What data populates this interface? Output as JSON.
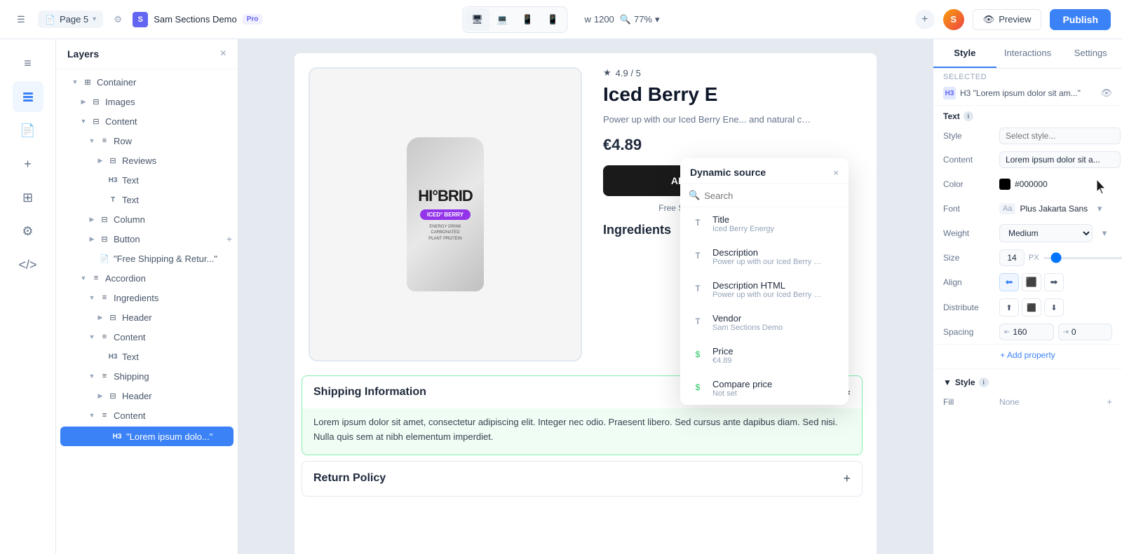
{
  "topbar": {
    "menu_icon": "☰",
    "page_name": "Page 5",
    "site_avatar_letter": "S",
    "site_name": "Sam Sections Demo",
    "pro_label": "Pro",
    "width_label": "w",
    "width_value": "1200",
    "zoom_icon": "🔍",
    "zoom_value": "77%",
    "add_icon": "+",
    "preview_label": "Preview",
    "publish_label": "Publish"
  },
  "layers": {
    "title": "Layers",
    "close_icon": "×",
    "items": [
      {
        "indent": 2,
        "expand": "▼",
        "type": "⊞",
        "name": "Container"
      },
      {
        "indent": 3,
        "expand": "▶",
        "type": "⊟",
        "name": "Images"
      },
      {
        "indent": 3,
        "expand": "▼",
        "type": "⊟",
        "name": "Content"
      },
      {
        "indent": 4,
        "expand": "▼",
        "type": "≡",
        "name": "Row"
      },
      {
        "indent": 5,
        "expand": "▶",
        "type": "⊟",
        "name": "Reviews"
      },
      {
        "indent": 5,
        "expand": "",
        "type": "T",
        "name": "H3 Text"
      },
      {
        "indent": 5,
        "expand": "",
        "type": "T",
        "name": "Text"
      },
      {
        "indent": 4,
        "expand": "▶",
        "type": "⊟",
        "name": "Column"
      },
      {
        "indent": 4,
        "expand": "▶",
        "type": "⊟",
        "name": "Button",
        "extra": "+"
      },
      {
        "indent": 4,
        "expand": "",
        "type": "📄",
        "name": "\"Free Shipping & Retur...\""
      },
      {
        "indent": 3,
        "expand": "▼",
        "type": "≡",
        "name": "Accordion"
      },
      {
        "indent": 4,
        "expand": "▼",
        "type": "≡",
        "name": "Ingredients"
      },
      {
        "indent": 5,
        "expand": "▶",
        "type": "⊟",
        "name": "Header"
      },
      {
        "indent": 4,
        "expand": "▼",
        "type": "≡",
        "name": "Content"
      },
      {
        "indent": 5,
        "expand": "",
        "type": "T",
        "name": "H3 Text"
      },
      {
        "indent": 4,
        "expand": "▼",
        "type": "≡",
        "name": "Shipping"
      },
      {
        "indent": 5,
        "expand": "▶",
        "type": "⊟",
        "name": "Header"
      },
      {
        "indent": 4,
        "expand": "▼",
        "type": "≡",
        "name": "Content"
      },
      {
        "indent": 5,
        "expand": "",
        "type": "T",
        "name": "H3 \"Lorem ipsum dolo...\"",
        "selected": true
      }
    ]
  },
  "dynamic_source": {
    "title": "Dynamic source",
    "close_icon": "×",
    "search_placeholder": "Search",
    "items": [
      {
        "icon": "T",
        "label": "Title",
        "value": "Iced Berry Energy"
      },
      {
        "icon": "T",
        "label": "Description",
        "value": "Power up with our Iced Berry Ener..."
      },
      {
        "icon": "T",
        "label": "Description HTML",
        "value": "Power up with our Iced Berry Ener..."
      },
      {
        "icon": "T",
        "label": "Vendor",
        "value": "Sam Sections Demo"
      },
      {
        "icon": "$",
        "label": "Price",
        "value": "€4.89"
      },
      {
        "icon": "$",
        "label": "Compare price",
        "value": "Not set"
      }
    ]
  },
  "canvas": {
    "rating": "★ 4.9 / 5",
    "product_name": "Iced Berry E",
    "description": "Power up with our Iced Berry Ene... and natural caffeine for a delicio...",
    "price": "€4.89",
    "add_to_cart": "ADD T",
    "free_shipping": "Free Shipping &",
    "ingredients_title": "Ingredients",
    "shipping_title": "Shipping Information",
    "shipping_text": "Lorem ipsum dolor sit amet, consectetur adipiscing elit. Integer nec odio. Praesent libero. Sed cursus ante dapibus diam. Sed nisi. Nulla quis sem at nibh elementum imperdiet.",
    "return_policy": "Return Policy",
    "can_brand": "HI°BRID",
    "can_label": "ICED° BERRY",
    "can_sub": "ENERGY DRINK\nCARBONATED\nPLANT PROTEIN"
  },
  "right_panel": {
    "tabs": [
      "Style",
      "Interactions",
      "Settings"
    ],
    "active_tab": "Style",
    "selected_label": "Selected",
    "selected_element": "H3 \"Lorem ipsum dolor sit am...\"",
    "eye_icon": "👁",
    "text_section": "Text",
    "props": {
      "style_label": "Style",
      "style_placeholder": "Select style...",
      "style_add": "+",
      "content_label": "Content",
      "content_value": "Lorem ipsum dolor sit a...",
      "content_icon": "⊞",
      "color_label": "Color",
      "color_hex": "#000000",
      "font_label": "Font",
      "font_icon": "Aa",
      "font_name": "Plus Jakarta Sans",
      "weight_label": "Weight",
      "weight_value": "Medium",
      "size_label": "Size",
      "size_value": "14",
      "size_unit": "PX",
      "align_label": "Align",
      "distribute_label": "Distribute",
      "spacing_label": "Spacing",
      "spacing_left_icon": "⇤",
      "spacing_left_value": "160",
      "spacing_right_icon": "⇥",
      "spacing_right_value": "0",
      "add_property": "+ Add property"
    },
    "style_section": "Style",
    "fill_label": "Fill",
    "fill_value": "None",
    "fill_add": "+"
  }
}
